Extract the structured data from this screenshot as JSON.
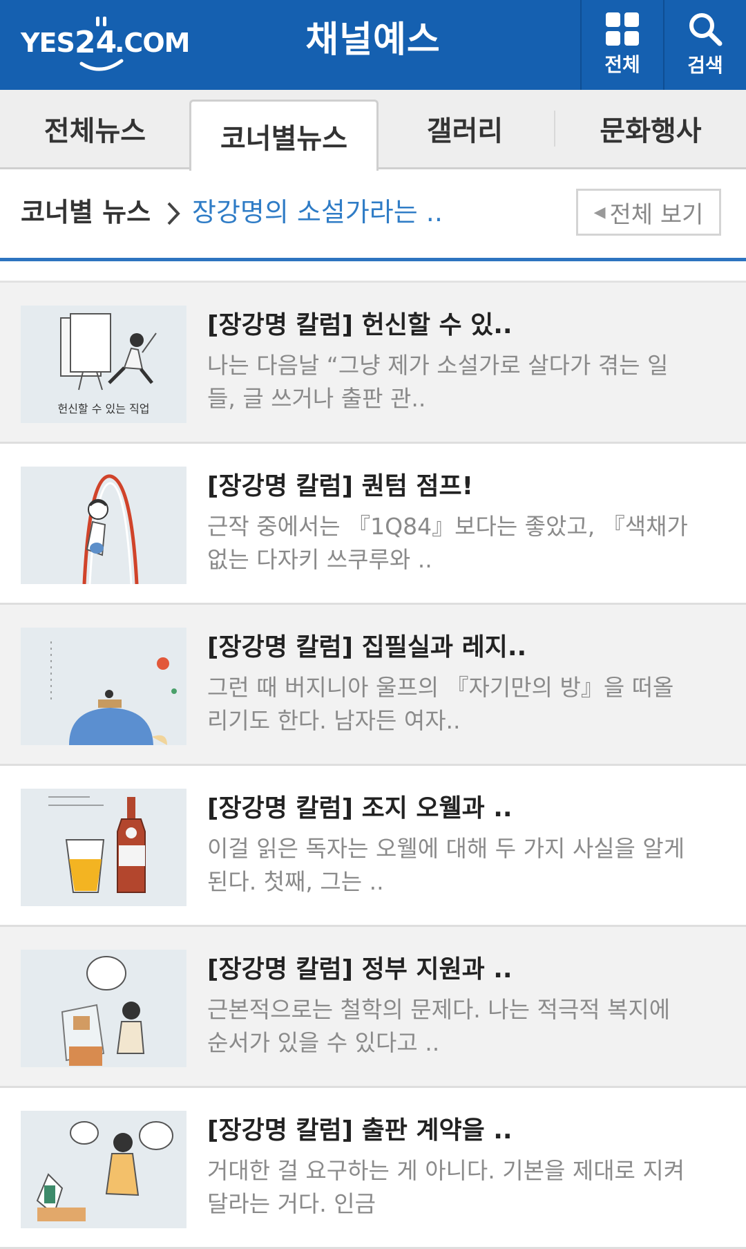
{
  "header": {
    "logo_text": "YES24.COM",
    "logo_parts": {
      "yes": "YES",
      "num": "24",
      "com": ".COM"
    },
    "title": "채널예스",
    "all_label": "전체",
    "search_label": "검색"
  },
  "tabs": [
    {
      "label": "전체뉴스",
      "active": false
    },
    {
      "label": "코너별뉴스",
      "active": true
    },
    {
      "label": "갤러리",
      "active": false
    },
    {
      "label": "문화행사",
      "active": false
    }
  ],
  "breadcrumb": {
    "root": "코너별 뉴스",
    "current": "장강명의 소설가라는 ..",
    "view_all": "전체 보기"
  },
  "articles": [
    {
      "title": "[장강명 칼럼] 헌신할 수 있..",
      "desc": "나는 다음날 “그냥 제가 소설가로 살다가 겪는 일들, 글 쓰거나 출판 관..",
      "thumb_caption": "헌신할 수 있는 직업"
    },
    {
      "title": "[장강명 칼럼] 퀀텀 점프!",
      "desc": "근작 중에서는 『1Q84』보다는 좋았고, 『색채가 없는 다자키 쓰쿠루와 ..",
      "thumb_caption": ""
    },
    {
      "title": "[장강명 칼럼] 집필실과 레지..",
      "desc": "그런 때 버지니아 울프의 『자기만의 방』을 떠올리기도 한다. 남자든 여자..",
      "thumb_caption": ""
    },
    {
      "title": "[장강명 칼럼] 조지 오웰과 ..",
      "desc": "이걸 읽은 독자는 오웰에 대해 두 가지 사실을 알게 된다. 첫째, 그는 ..",
      "thumb_caption": ""
    },
    {
      "title": "[장강명 칼럼] 정부 지원과 ..",
      "desc": "근본적으로는 철학의 문제다. 나는 적극적 복지에 순서가 있을 수 있다고 ..",
      "thumb_caption": ""
    },
    {
      "title": "[장강명 칼럼] 출판 계약을 ..",
      "desc": "거대한 걸 요구하는 게 아니다. 기본을 제대로 지켜 달라는 거다. 인금",
      "thumb_caption": ""
    }
  ],
  "colors": {
    "brand": "#1560b0",
    "link": "#2f7cc6"
  }
}
